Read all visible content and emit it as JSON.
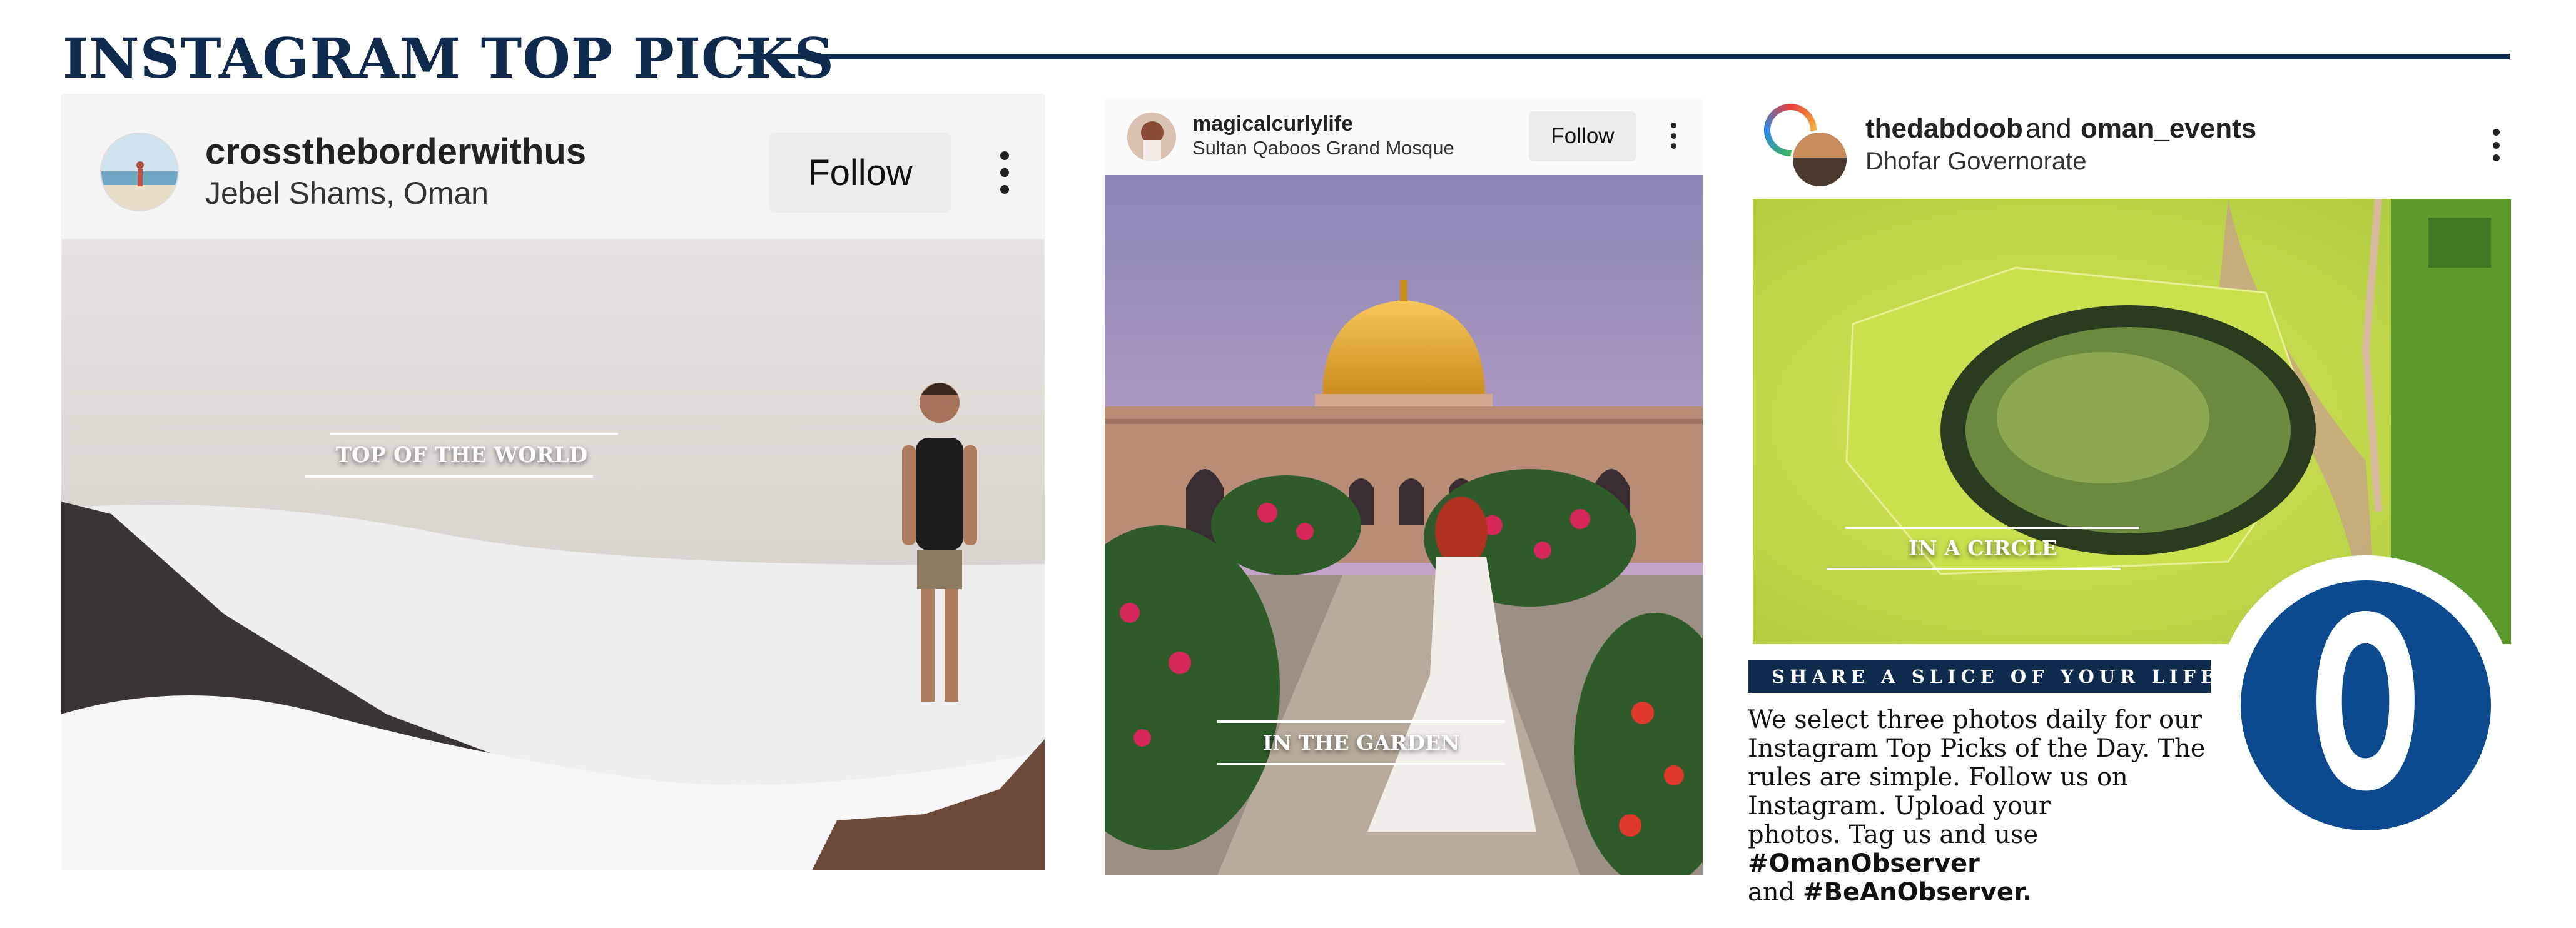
{
  "header": {
    "title": "INSTAGRAM TOP PICKS"
  },
  "posts": [
    {
      "username": "crosstheborderwithus",
      "location": "Jebel Shams, Oman",
      "follow_label": "Follow",
      "caption": "TOP OF THE WORLD"
    },
    {
      "username": "magicalcurlylife",
      "location": "Sultan Qaboos Grand Mosque",
      "follow_label": "Follow",
      "caption": "IN THE GARDEN"
    },
    {
      "username_1": "thedabdoob",
      "and_word": "and",
      "username_2": "oman_events",
      "location": "Dhofar Governorate",
      "caption": "IN A CIRCLE"
    }
  ],
  "sidebar": {
    "heading": "SHARE A SLICE OF YOUR LIFE",
    "body_lines": [
      "We select three photos daily for our",
      "Instagram Top Picks of the Day. The",
      "rules are simple. Follow us on",
      "Instagram. Upload your"
    ],
    "line5_text": "photos. Tag us and use ",
    "hashtag_1": "#OmanObserver",
    "line6_text": "and ",
    "hashtag_2": "#BeAnObserver."
  },
  "logo": {
    "letter": "O",
    "color": "#0b4a8f"
  },
  "colors": {
    "navy": "#0f2a4c",
    "logo_blue": "#0b4a8f"
  },
  "icons": [
    "kebab-menu-icon",
    "avatar-photo"
  ]
}
